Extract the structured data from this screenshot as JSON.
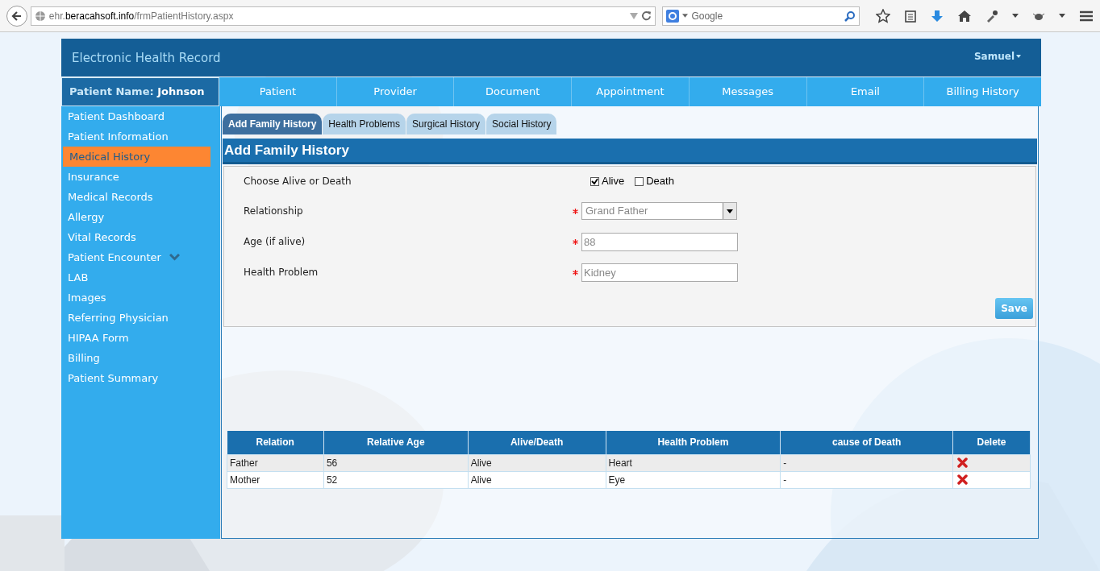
{
  "browser": {
    "url_host": "ehr.",
    "url_domain": "beracahsoft.info",
    "url_path": "/frmPatientHistory.aspx",
    "search_placeholder": "Google"
  },
  "header": {
    "title": "Electronic Health Record",
    "user": "Samuel"
  },
  "patient": {
    "label": "Patient Name:",
    "name": "Johnson"
  },
  "nav": [
    "Patient",
    "Provider",
    "Document",
    "Appointment",
    "Messages",
    "Email",
    "Billing History"
  ],
  "sidebar": {
    "items": [
      {
        "label": "Patient Dashboard",
        "selected": false
      },
      {
        "label": "Patient Information",
        "selected": false
      },
      {
        "label": "Medical History",
        "selected": true
      },
      {
        "label": "Insurance",
        "selected": false
      },
      {
        "label": "Medical Records",
        "selected": false
      },
      {
        "label": "Allergy",
        "selected": false
      },
      {
        "label": "Vital Records",
        "selected": false
      },
      {
        "label": "Patient Encounter",
        "selected": false,
        "expandable": true
      },
      {
        "label": "LAB",
        "selected": false
      },
      {
        "label": "Images",
        "selected": false
      },
      {
        "label": "Referring Physician",
        "selected": false
      },
      {
        "label": "HIPAA Form",
        "selected": false
      },
      {
        "label": "Billing",
        "selected": false
      },
      {
        "label": "Patient Summary",
        "selected": false
      }
    ]
  },
  "tabs": [
    {
      "label": "Add Family History",
      "selected": true
    },
    {
      "label": "Health Problems",
      "selected": false
    },
    {
      "label": "Surgical History",
      "selected": false
    },
    {
      "label": "Social History",
      "selected": false
    }
  ],
  "section_title": "Add Family History",
  "form": {
    "status_label": "Choose Alive or Death",
    "status_options": [
      {
        "label": "Alive",
        "checked": true
      },
      {
        "label": "Death",
        "checked": false
      }
    ],
    "fields": [
      {
        "label": "Relationship",
        "kind": "select",
        "value": "Grand Father",
        "required": true
      },
      {
        "label": "Age (if alive)",
        "kind": "text",
        "value": "88",
        "required": true
      },
      {
        "label": "Health Problem",
        "kind": "text",
        "value": "Kidney",
        "required": true
      }
    ],
    "save": "Save"
  },
  "table": {
    "columns": [
      "Relation",
      "Relative Age",
      "Alive/Death",
      "Health Problem",
      "cause of Death",
      "Delete"
    ],
    "rows": [
      [
        "Father",
        "56",
        "Alive",
        "Heart",
        "-"
      ],
      [
        "Mother",
        "52",
        "Alive",
        "Eye",
        "-"
      ]
    ]
  }
}
